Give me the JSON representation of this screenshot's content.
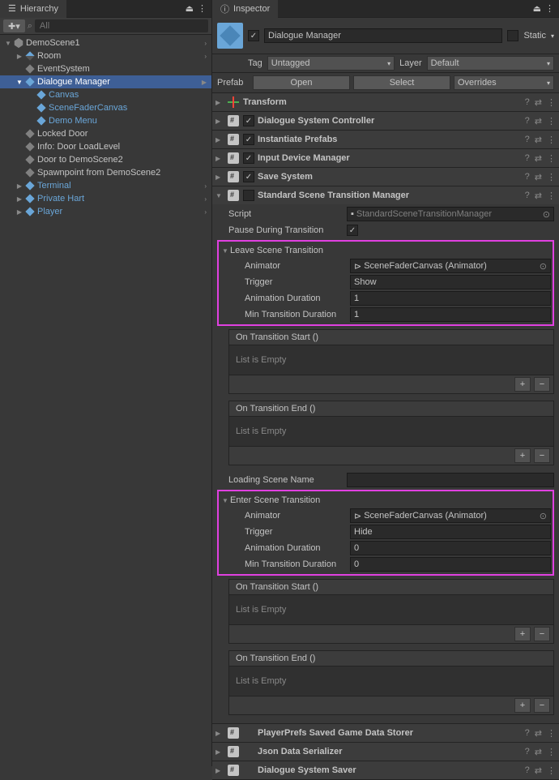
{
  "hierarchy": {
    "title": "Hierarchy",
    "search_placeholder": "All",
    "items": [
      {
        "label": "DemoScene1",
        "depth": 0,
        "icon": "unity",
        "expanded": true,
        "chev": true
      },
      {
        "label": "Room",
        "depth": 1,
        "icon": "cube-var",
        "collapsed": true,
        "chev": true
      },
      {
        "label": "EventSystem",
        "depth": 1,
        "icon": "cube-gray"
      },
      {
        "label": "Dialogue Manager",
        "depth": 1,
        "icon": "cube-blue",
        "blue": true,
        "expanded": true,
        "selected": true,
        "chev": true
      },
      {
        "label": "Canvas",
        "depth": 2,
        "icon": "cube-blue",
        "blue": true
      },
      {
        "label": "SceneFaderCanvas",
        "depth": 2,
        "icon": "cube-blue",
        "blue": true
      },
      {
        "label": "Demo Menu",
        "depth": 2,
        "icon": "cube-blue",
        "blue": true
      },
      {
        "label": "Locked Door",
        "depth": 1,
        "icon": "cube-gray"
      },
      {
        "label": "Info: Door LoadLevel",
        "depth": 1,
        "icon": "cube-gray"
      },
      {
        "label": "Door to DemoScene2",
        "depth": 1,
        "icon": "cube-gray"
      },
      {
        "label": "Spawnpoint from DemoScene2",
        "depth": 1,
        "icon": "cube-gray"
      },
      {
        "label": "Terminal",
        "depth": 1,
        "icon": "cube-blue",
        "blue": true,
        "collapsed": true,
        "chev": true
      },
      {
        "label": "Private Hart",
        "depth": 1,
        "icon": "cube-blue",
        "blue": true,
        "collapsed": true,
        "chev": true
      },
      {
        "label": "Player",
        "depth": 1,
        "icon": "cube-blue",
        "blue": true,
        "collapsed": true,
        "chev": true
      }
    ]
  },
  "inspector": {
    "title": "Inspector",
    "object_name": "Dialogue Manager",
    "static_label": "Static",
    "tag_label": "Tag",
    "tag_value": "Untagged",
    "layer_label": "Layer",
    "layer_value": "Default",
    "prefab_label": "Prefab",
    "prefab_open": "Open",
    "prefab_select": "Select",
    "prefab_overrides": "Overrides",
    "components": [
      {
        "title": "Transform",
        "icon": "transform",
        "checkbox": false
      },
      {
        "title": "Dialogue System Controller",
        "icon": "script",
        "checkbox": true
      },
      {
        "title": "Instantiate Prefabs",
        "icon": "script",
        "checkbox": true
      },
      {
        "title": "Input Device Manager",
        "icon": "script",
        "checkbox": true
      },
      {
        "title": "Save System",
        "icon": "script",
        "checkbox": true
      }
    ],
    "sstm": {
      "title": "Standard Scene Transition Manager",
      "script_label": "Script",
      "script_value": "StandardSceneTransitionManager",
      "pause_label": "Pause During Transition",
      "leave": {
        "title": "Leave Scene Transition",
        "animator_label": "Animator",
        "animator_value": "SceneFaderCanvas (Animator)",
        "trigger_label": "Trigger",
        "trigger_value": "Show",
        "anim_dur_label": "Animation Duration",
        "anim_dur_value": "1",
        "min_dur_label": "Min Transition Duration",
        "min_dur_value": "1"
      },
      "on_start": "On Transition Start ()",
      "on_end": "On Transition End ()",
      "list_empty": "List is Empty",
      "loading_label": "Loading Scene Name",
      "enter": {
        "title": "Enter Scene Transition",
        "animator_label": "Animator",
        "animator_value": "SceneFaderCanvas (Animator)",
        "trigger_label": "Trigger",
        "trigger_value": "Hide",
        "anim_dur_label": "Animation Duration",
        "anim_dur_value": "0",
        "min_dur_label": "Min Transition Duration",
        "min_dur_value": "0"
      }
    },
    "bottom_components": [
      {
        "title": "PlayerPrefs Saved Game Data Storer"
      },
      {
        "title": "Json Data Serializer"
      },
      {
        "title": "Dialogue System Saver"
      }
    ]
  }
}
